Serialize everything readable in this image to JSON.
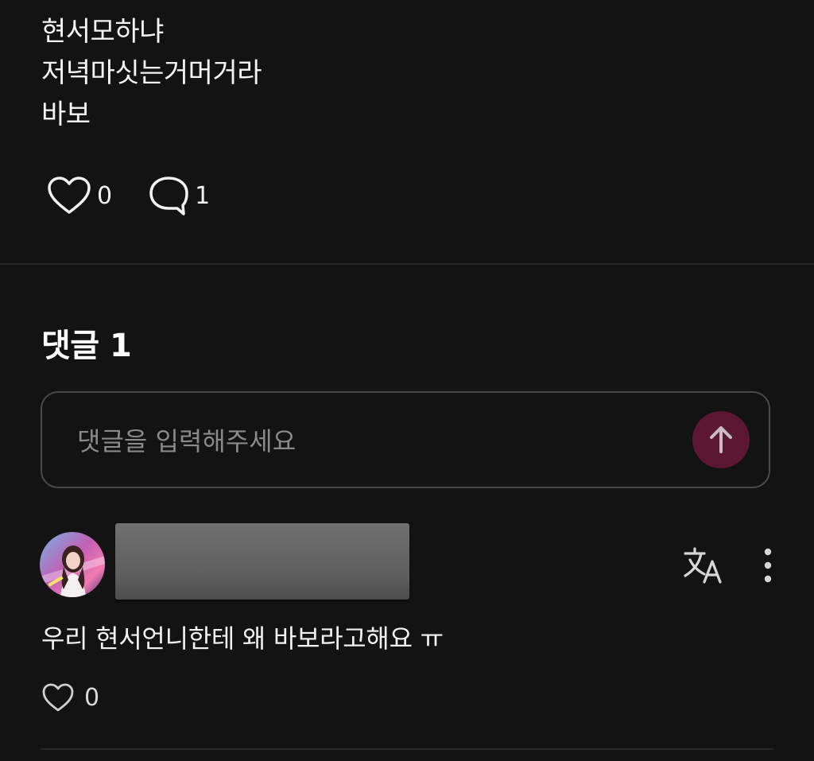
{
  "post": {
    "lines": [
      "현서모하냐",
      "저녁마싯는거머거라",
      "바보"
    ],
    "like_count": "0",
    "comment_count": "1"
  },
  "comments_section": {
    "heading": "댓글 1",
    "input_placeholder": "댓글을 입력해주세요",
    "accent_color": "#5c1733"
  },
  "comment": {
    "text": "우리 현서언니한테 왜 바보라고해요 ㅠ",
    "like_count": "0",
    "icons": [
      "translate-icon",
      "more-vertical-icon",
      "heart-outline-icon"
    ]
  }
}
